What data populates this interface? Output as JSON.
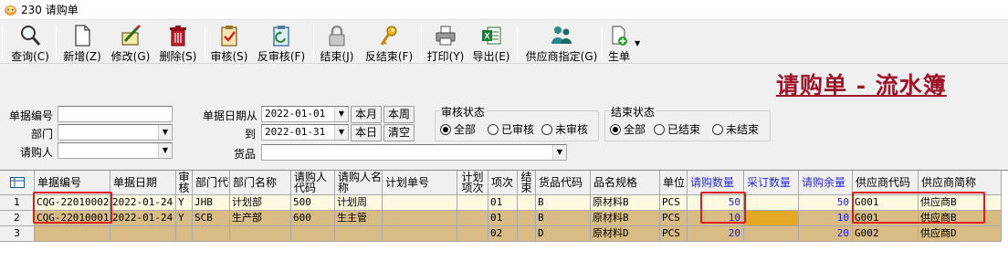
{
  "window": {
    "title": "230 请购单"
  },
  "toolbar": {
    "buttons": [
      {
        "label": "查询(C)",
        "icon": "search-icon"
      },
      {
        "label": "新增(Z)",
        "icon": "new-document-icon"
      },
      {
        "label": "修改(G)",
        "icon": "edit-icon"
      },
      {
        "label": "删除(S)",
        "icon": "delete-trash-icon"
      },
      {
        "label": "审核(S)",
        "icon": "approve-clipboard-icon"
      },
      {
        "label": "反审核(F)",
        "icon": "unapprove-clipboard-icon"
      },
      {
        "label": "结束(J)",
        "icon": "lock-icon"
      },
      {
        "label": "反结束(F)",
        "icon": "key-icon"
      },
      {
        "label": "打印(Y)",
        "icon": "printer-icon"
      },
      {
        "label": "导出(E)",
        "icon": "excel-export-icon"
      },
      {
        "label": "供应商指定(G)",
        "icon": "suppliers-icon"
      },
      {
        "label": "生单",
        "icon": "generate-order-icon"
      }
    ]
  },
  "heading": "请购单 - 流水簿",
  "filters": {
    "doc_no_label": "单据编号",
    "dept_label": "部门",
    "requester_label": "请购人",
    "date_from_label": "单据日期从",
    "date_to_label": "到",
    "date_from": "2022-01-01",
    "date_to": "2022-01-31",
    "goods_label": "货品",
    "btn_this_month": "本月",
    "btn_this_week": "本周",
    "btn_today": "本日",
    "btn_clear": "清空",
    "audit_group": {
      "title": "审核状态",
      "options": [
        "全部",
        "已审核",
        "未审核"
      ],
      "selected": "全部"
    },
    "end_group": {
      "title": "结束状态",
      "options": [
        "全部",
        "已结束",
        "未结束"
      ],
      "selected": "全部"
    }
  },
  "grid": {
    "headers": [
      "单据编号",
      "单据日期",
      "审核",
      "部门代码",
      "部门名称",
      "请购人代码",
      "请购人名称",
      "计划单号",
      "计划项次",
      "项次",
      "结束",
      "货品代码",
      "品名规格",
      "单位",
      "请购数量",
      "采订数量",
      "请购余量",
      "供应商代码",
      "供应商简称"
    ],
    "rows": [
      {
        "row_no": "1",
        "doc_no": "CQG-22010002",
        "date": "2022-01-24",
        "audited": "Y",
        "dept_code": "JHB",
        "dept_name": "计划部",
        "req_code": "500",
        "req_name": "计划周",
        "plan_no": "",
        "plan_item": "",
        "item_no": "01",
        "ended": "",
        "goods_code": "B",
        "goods_name": "原材料B",
        "unit": "PCS",
        "req_qty": "50",
        "ord_qty": "",
        "remain_qty": "50",
        "supplier_code": "G001",
        "supplier_name": "供应商B"
      },
      {
        "row_no": "2",
        "doc_no": "CQG-22010001",
        "date": "2022-01-24",
        "audited": "Y",
        "dept_code": "SCB",
        "dept_name": "生产部",
        "req_code": "600",
        "req_name": "生主管",
        "plan_no": "",
        "plan_item": "",
        "item_no": "01",
        "ended": "",
        "goods_code": "B",
        "goods_name": "原材料B",
        "unit": "PCS",
        "req_qty": "10",
        "ord_qty": "",
        "remain_qty": "10",
        "supplier_code": "G001",
        "supplier_name": "供应商B"
      },
      {
        "row_no": "3",
        "doc_no": "",
        "date": "",
        "audited": "",
        "dept_code": "",
        "dept_name": "",
        "req_code": "",
        "req_name": "",
        "plan_no": "",
        "plan_item": "",
        "item_no": "02",
        "ended": "",
        "goods_code": "D",
        "goods_name": "原材料D",
        "unit": "PCS",
        "req_qty": "20",
        "ord_qty": "",
        "remain_qty": "20",
        "supplier_code": "G002",
        "supplier_name": "供应商D"
      }
    ]
  },
  "colors": {
    "heading": "#a0142a",
    "highlight_box": "#e01a1a",
    "row1_bg": "#fdf9e0",
    "row_bg": "#d9bb86",
    "order_qty_cell": "#e3a825",
    "qty_text": "#1a1ae6"
  }
}
